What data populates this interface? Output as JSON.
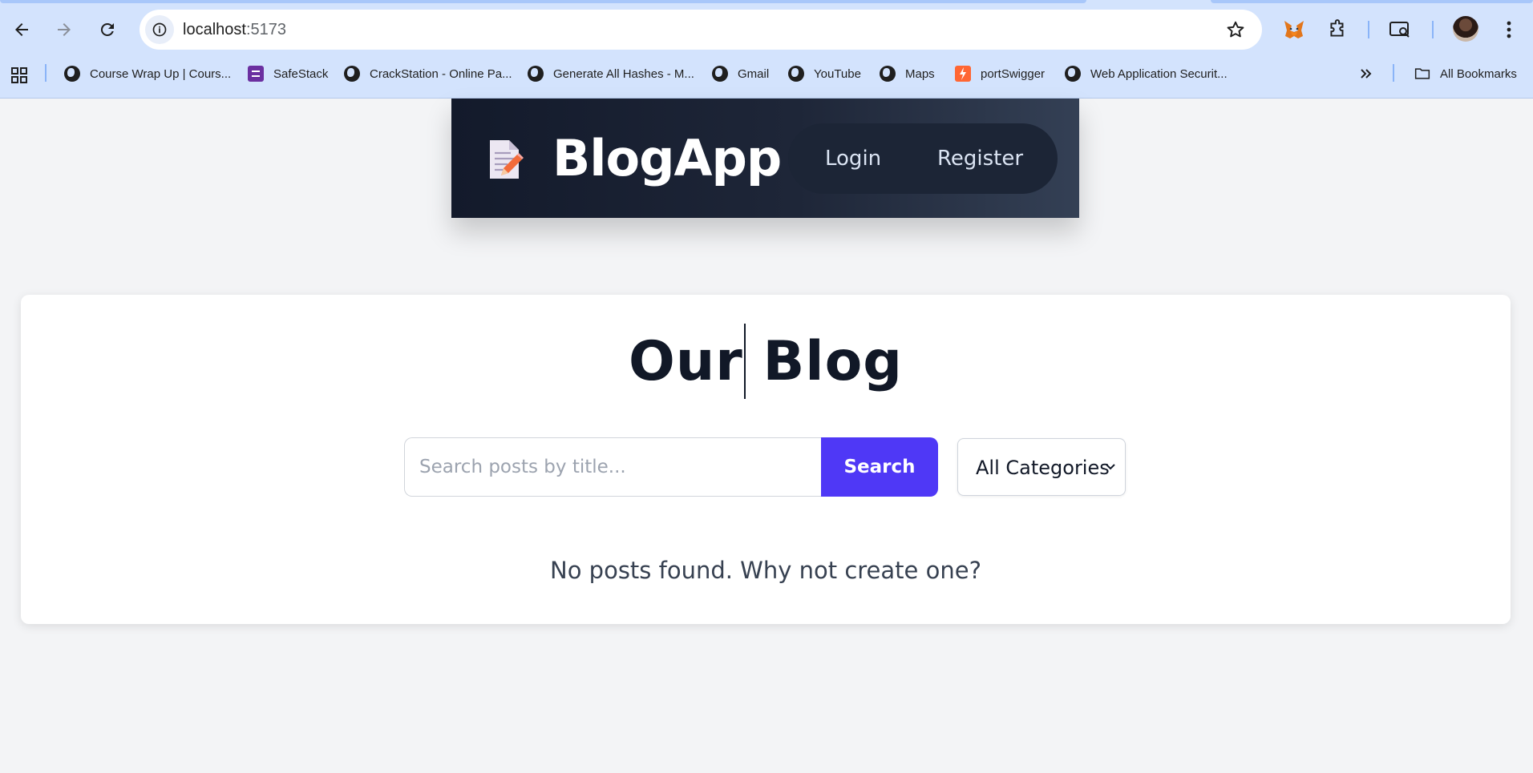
{
  "browser": {
    "url_host": "localhost",
    "url_port": ":5173",
    "bookmarks": [
      {
        "label": "Course Wrap Up | Cours...",
        "icon": "globe-icon"
      },
      {
        "label": "SafeStack",
        "icon": "safestack-icon"
      },
      {
        "label": "CrackStation - Online Pa...",
        "icon": "globe-icon"
      },
      {
        "label": "Generate All Hashes - M...",
        "icon": "globe-icon"
      },
      {
        "label": "Gmail",
        "icon": "globe-icon"
      },
      {
        "label": "YouTube",
        "icon": "globe-icon"
      },
      {
        "label": "Maps",
        "icon": "globe-icon"
      },
      {
        "label": "portSwigger",
        "icon": "portswigger-icon"
      },
      {
        "label": "Web Application Securit...",
        "icon": "globe-icon"
      }
    ],
    "all_bookmarks": "All Bookmarks"
  },
  "header": {
    "brand": "BlogApp",
    "nav": {
      "login": "Login",
      "register": "Register"
    }
  },
  "main": {
    "title": "Our Blog",
    "search": {
      "placeholder": "Search posts by title...",
      "value": "",
      "button": "Search"
    },
    "category": {
      "selected": "All Categories"
    },
    "empty_message": "No posts found. Why not create one?"
  },
  "colors": {
    "accent": "#4f38f6",
    "header_dark": "#131a2b",
    "page_bg": "#f3f4f6",
    "chrome_bg": "#d3e3fd"
  }
}
